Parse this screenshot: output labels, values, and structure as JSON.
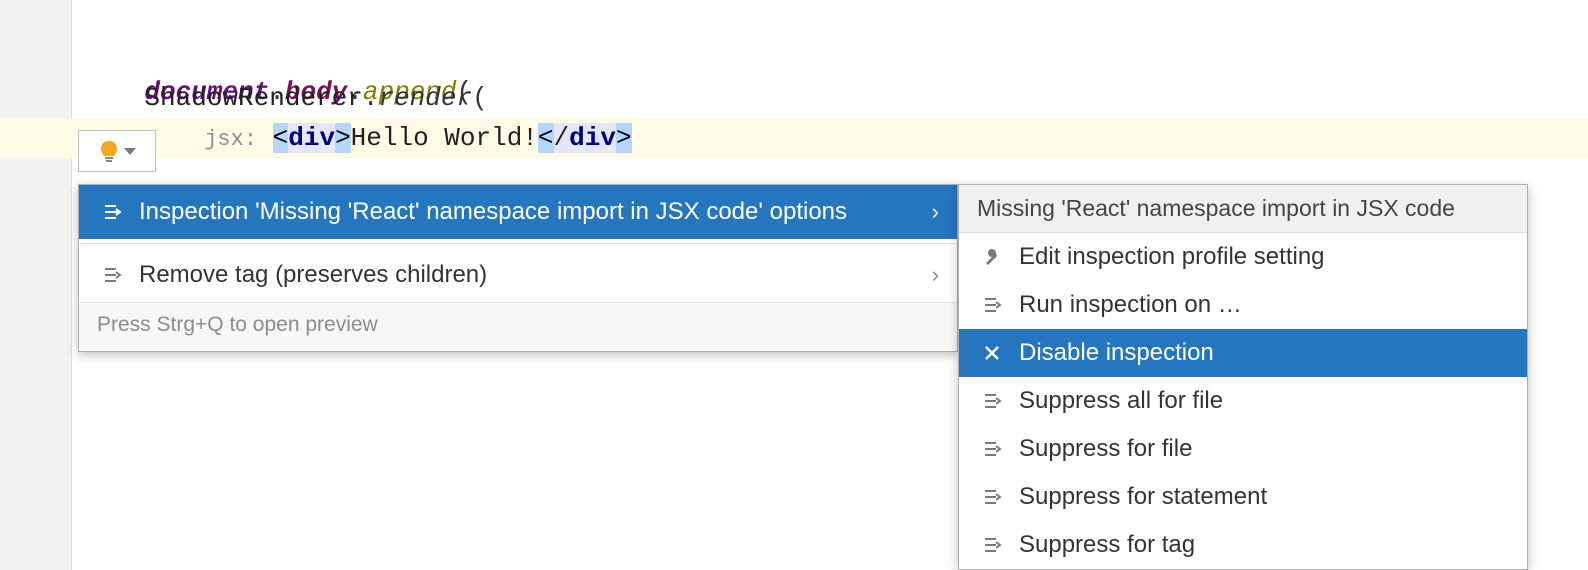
{
  "code": {
    "line1": {
      "document": "document",
      "body": "body",
      "append": "append",
      "dot": ".",
      "open_paren": "("
    },
    "line2": {
      "class_name": "ShadowRenderer",
      "dot": ".",
      "render": "render",
      "open_paren": "("
    },
    "line3": {
      "hint": "jsx:",
      "lt": "<",
      "tag": "div",
      "gt": ">",
      "text": "Hello World!",
      "lt2": "<",
      "slash": "/",
      "tag2": "div",
      "gt2": ">"
    }
  },
  "menu1": {
    "items": [
      {
        "label": "Inspection 'Missing 'React' namespace import in JSX code' options",
        "icon": "intention-icon",
        "has_submenu": true,
        "selected": true
      },
      {
        "label": "Remove tag (preserves children)",
        "icon": "intention-icon",
        "has_submenu": true,
        "selected": false
      }
    ],
    "hint": "Press Strg+Q to open preview"
  },
  "menu2": {
    "header": "Missing 'React' namespace import in JSX code",
    "items": [
      {
        "label": "Edit inspection profile setting",
        "icon": "wrench-icon",
        "selected": false
      },
      {
        "label": "Run inspection on …",
        "icon": "intention-icon",
        "selected": false
      },
      {
        "label": "Disable inspection",
        "icon": "close-icon",
        "selected": true
      },
      {
        "label": "Suppress all for file",
        "icon": "intention-icon",
        "selected": false
      },
      {
        "label": "Suppress for file",
        "icon": "intention-icon",
        "selected": false
      },
      {
        "label": "Suppress for statement",
        "icon": "intention-icon",
        "selected": false
      },
      {
        "label": "Suppress for tag",
        "icon": "intention-icon",
        "selected": false
      }
    ]
  }
}
